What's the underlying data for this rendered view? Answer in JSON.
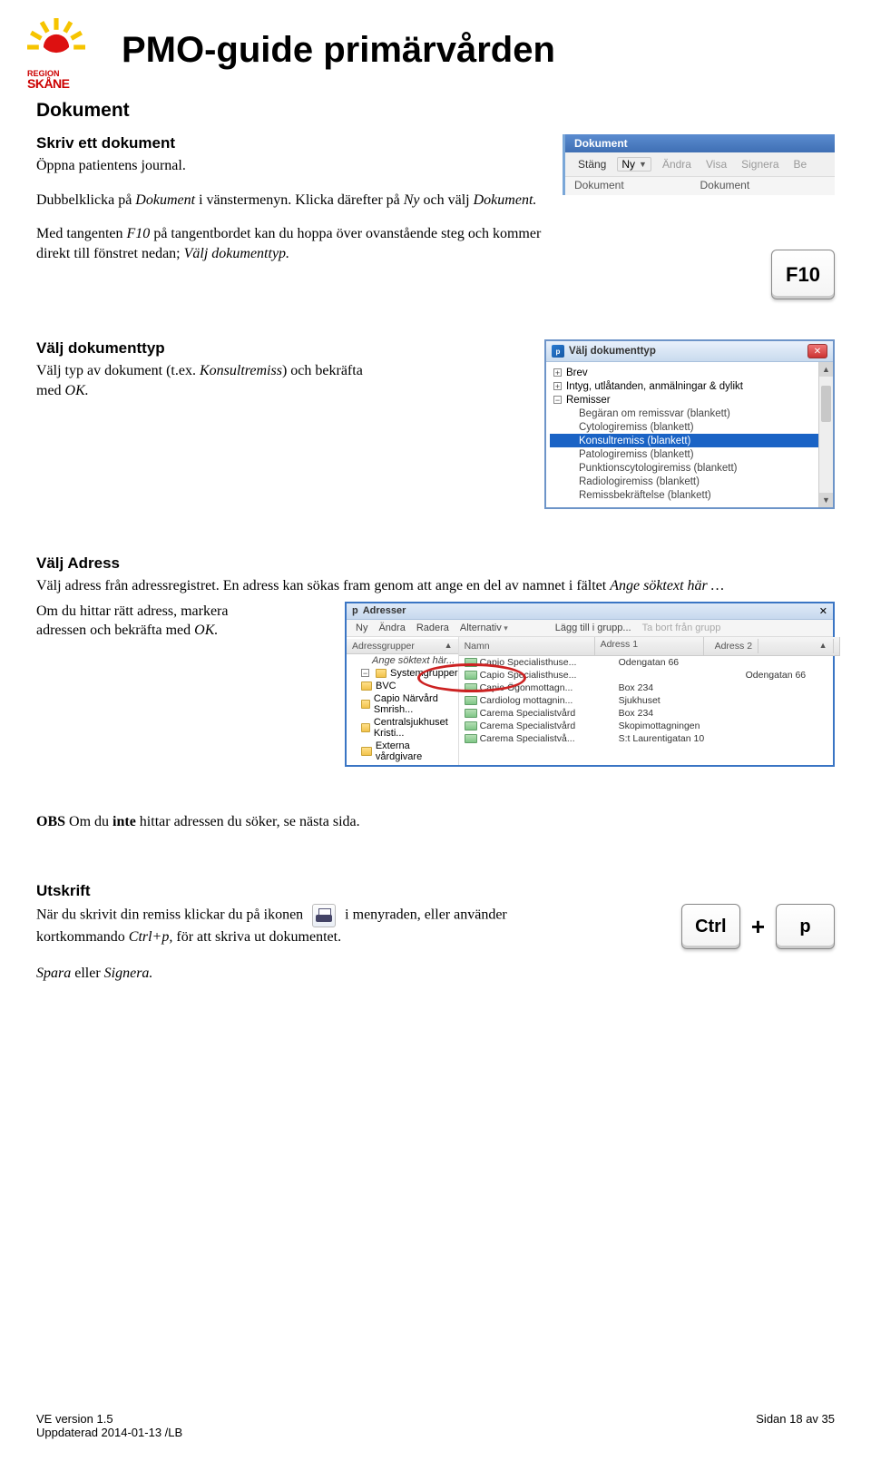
{
  "header": {
    "logo_region": "REGION",
    "logo_name": "SKÅNE",
    "title": "PMO-guide primärvården"
  },
  "section1": {
    "heading": "Dokument",
    "sub": "Skriv ett dokument",
    "p1a": "Öppna patientens journal.",
    "p2a": "Dubbelklicka på ",
    "p2b": "Dokument",
    "p2c": " i vänstermenyn. Klicka därefter på ",
    "p2d": "Ny",
    "p2e": " och välj ",
    "p2f": "Dokument.",
    "p3a": "Med tangenten ",
    "p3b": "F10",
    "p3c": " på tangentbordet kan du hoppa över ovanstående steg och kommer direkt till fönstret nedan; ",
    "p3d": "Välj dokumenttyp."
  },
  "toolbar_shot": {
    "bar_title": "Dokument",
    "stang": "Stäng",
    "ny": "Ny",
    "andra": "Ändra",
    "visa": "Visa",
    "signera": "Signera",
    "be": "Be",
    "col1": "Dokument",
    "col2": "Dokument"
  },
  "key_f10_label": "F10",
  "section2": {
    "heading": "Välj dokumenttyp",
    "p1a": "Välj typ av dokument (t.ex. ",
    "p1b": "Konsultremiss",
    "p1c": ") och bekräfta med ",
    "p1d": "OK."
  },
  "tree_shot": {
    "title": "Välj dokumenttyp",
    "items": [
      {
        "lvl": "top",
        "box": "+",
        "label": "Brev"
      },
      {
        "lvl": "top",
        "box": "+",
        "label": "Intyg, utlåtanden, anmälningar & dylikt"
      },
      {
        "lvl": "top",
        "box": "−",
        "label": "Remisser"
      },
      {
        "lvl": "sub",
        "label": "Begäran om remissvar (blankett)"
      },
      {
        "lvl": "sub",
        "label": "Cytologiremiss (blankett)"
      },
      {
        "lvl": "sel",
        "label": "Konsultremiss (blankett)"
      },
      {
        "lvl": "sub",
        "label": "Patologiremiss (blankett)"
      },
      {
        "lvl": "sub",
        "label": "Punktionscytologiremiss (blankett)"
      },
      {
        "lvl": "sub",
        "label": "Radiologiremiss (blankett)"
      },
      {
        "lvl": "sub",
        "label": "Remissbekräftelse (blankett)"
      }
    ]
  },
  "section3": {
    "heading": "Välj Adress",
    "p1a": "Välj adress från adressregistret. En adress kan sökas fram genom att ange en del av namnet i fältet ",
    "p1b": "Ange söktext här …",
    "p2a": "Om du hittar rätt adress, markera adressen och bekräfta med ",
    "p2b": "OK."
  },
  "addr_shot": {
    "title": "Adresser",
    "menu": {
      "ny": "Ny",
      "andra": "Ändra",
      "radera": "Radera",
      "alt": "Alternativ",
      "laggtill": "Lägg till i grupp...",
      "tabort": "Ta bort från grupp"
    },
    "left_hdr": "Adressgrupper",
    "left_items": [
      {
        "type": "search",
        "label": "Ange söktext här..."
      },
      {
        "type": "folder",
        "box": "−",
        "label": "Systemgrupper"
      },
      {
        "type": "folder",
        "label": "BVC"
      },
      {
        "type": "folder",
        "label": "Capio Närvård Smrish..."
      },
      {
        "type": "folder",
        "label": "Centralsjukhuset Kristi..."
      },
      {
        "type": "folder",
        "label": "Externa vårdgivare"
      }
    ],
    "cols": {
      "c1": "Namn",
      "c2": "Adress 1",
      "c3": "Adress 2"
    },
    "rows": [
      {
        "n": "Capio Specialisthuse...",
        "a1": "Odengatan 66",
        "a2": ""
      },
      {
        "n": "Capio Specialisthuse...",
        "a1": "",
        "a2": "Odengatan 66"
      },
      {
        "n": "Capio Ögonmottagn...",
        "a1": "Box 234",
        "a2": ""
      },
      {
        "n": "Cardiolog mottagnin...",
        "a1": "Sjukhuset",
        "a2": ""
      },
      {
        "n": "Carema Specialistvård",
        "a1": "Box 234",
        "a2": ""
      },
      {
        "n": "Carema Specialistvård",
        "a1": "Skopimottagningen",
        "a2": ""
      },
      {
        "n": "Carema Specialistvå...",
        "a1": "S:t Laurentigatan 10",
        "a2": ""
      }
    ]
  },
  "obs": {
    "a": "OBS",
    "b": " Om du ",
    "c": "inte",
    "d": " hittar adressen du söker, se nästa sida."
  },
  "section4": {
    "heading": "Utskrift",
    "p1a": "När du skrivit din remiss klickar du på ikonen",
    "p1b": "i menyraden, eller använder kortkommando ",
    "p1c": "Ctrl+p,",
    "p1d": " för att skriva ut dokumentet.",
    "p2a": "Spara",
    "p2b": " eller ",
    "p2c": "Signera."
  },
  "keys": {
    "ctrl": "Ctrl",
    "plus": "+",
    "p": "p"
  },
  "footer": {
    "left1": "VE version 1.5",
    "left2": "Uppdaterad 2014-01-13 /LB",
    "right": "Sidan 18 av 35"
  }
}
